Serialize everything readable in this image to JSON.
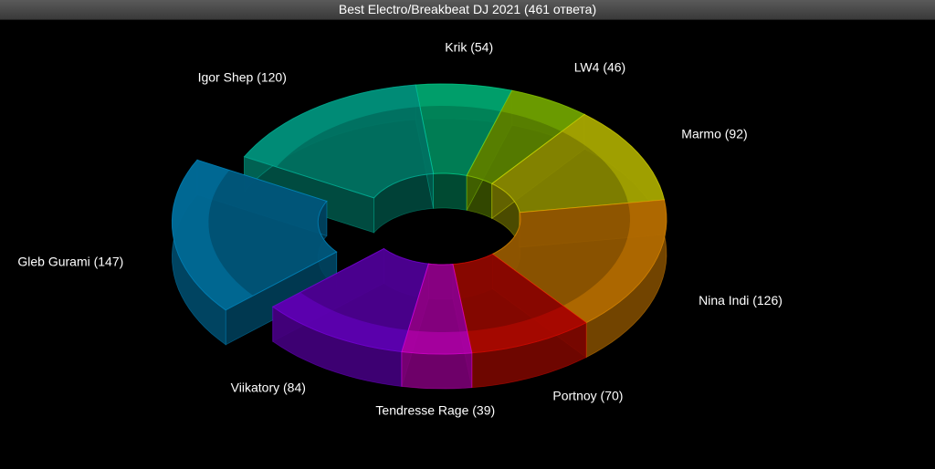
{
  "window": {
    "title": "Best Electro/Breakbeat DJ 2021 (461 ответа)"
  },
  "chart_data": {
    "type": "pie",
    "variant": "3d-donut",
    "title": "Best Electro/Breakbeat DJ 2021 (461 ответа)",
    "total": 461,
    "slices": [
      {
        "name": "Krik",
        "value": 54,
        "label": "Krik (54)",
        "color": "#00b77a"
      },
      {
        "name": "LW4",
        "value": 46,
        "label": "LW4 (46)",
        "color": "#7ab000"
      },
      {
        "name": "Marmo",
        "value": 92,
        "label": "Marmo (92)",
        "color": "#b8b800"
      },
      {
        "name": "Nina Indi",
        "value": 126,
        "label": "Nina Indi (126)",
        "color": "#c87800"
      },
      {
        "name": "Portnoy",
        "value": 70,
        "label": "Portnoy (70)",
        "color": "#c00a00"
      },
      {
        "name": "Tendresse Rage",
        "value": 39,
        "label": "Tendresse Rage (39)",
        "color": "#c000b8"
      },
      {
        "name": "Viikatory",
        "value": 84,
        "label": "Viikatory (84)",
        "color": "#6a00c8"
      },
      {
        "name": "Gleb Gurami",
        "value": 147,
        "label": "Gleb Gurami (147)",
        "color": "#0078aa",
        "exploded": true
      },
      {
        "name": "Igor Shep",
        "value": 120,
        "label": "Igor Shep (120)",
        "color": "#00a088"
      }
    ]
  }
}
